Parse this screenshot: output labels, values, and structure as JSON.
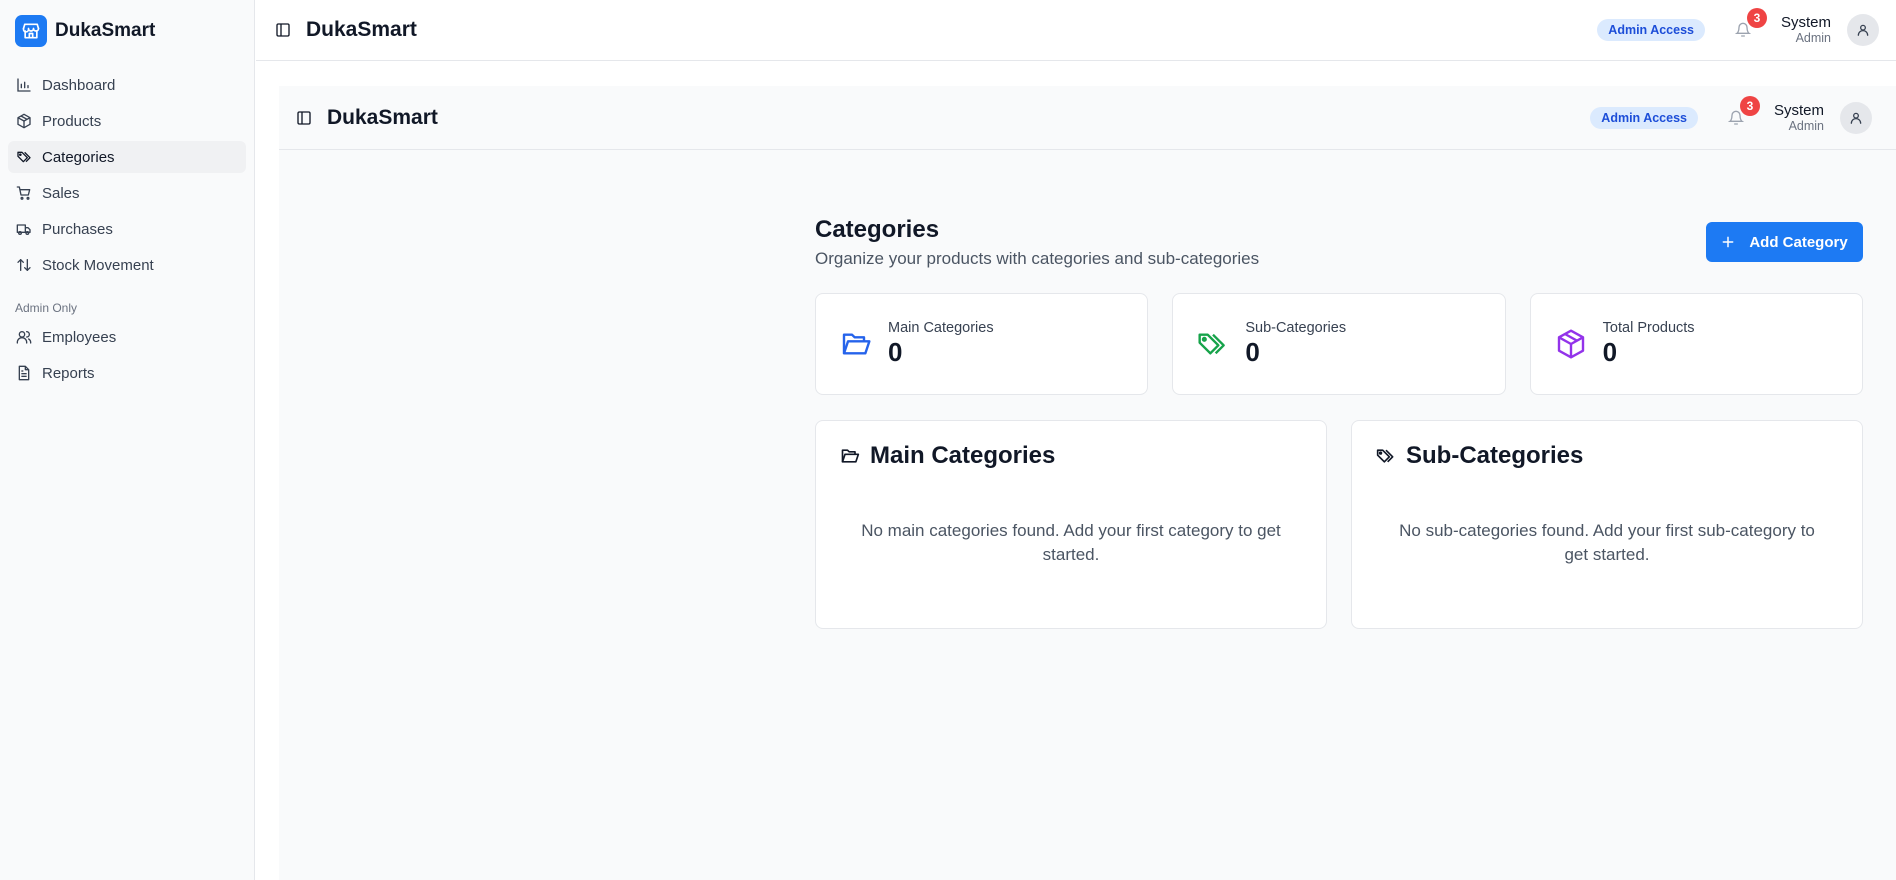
{
  "app": {
    "name": "DukaSmart"
  },
  "sidebar": {
    "items": [
      {
        "label": "Dashboard",
        "icon": "bar-chart-icon",
        "active": false
      },
      {
        "label": "Products",
        "icon": "package-icon",
        "active": false
      },
      {
        "label": "Categories",
        "icon": "tags-icon",
        "active": true
      },
      {
        "label": "Sales",
        "icon": "shopping-cart-icon",
        "active": false
      },
      {
        "label": "Purchases",
        "icon": "truck-icon",
        "active": false
      },
      {
        "label": "Stock Movement",
        "icon": "arrow-up-down-icon",
        "active": false
      }
    ],
    "admin_section_label": "Admin Only",
    "admin_items": [
      {
        "label": "Employees",
        "icon": "users-icon"
      },
      {
        "label": "Reports",
        "icon": "file-text-icon"
      }
    ]
  },
  "header": {
    "title": "DukaSmart",
    "access_badge": "Admin Access",
    "notification_count": "3",
    "user_name": "System",
    "user_role": "Admin"
  },
  "page": {
    "title": "Categories",
    "subtitle": "Organize your products with categories and sub-categories",
    "add_button_label": "Add Category"
  },
  "stats": [
    {
      "label": "Main Categories",
      "value": "0",
      "icon": "folder-open-icon",
      "color": "#2563eb"
    },
    {
      "label": "Sub-Categories",
      "value": "0",
      "icon": "tags-icon",
      "color": "#16a34a"
    },
    {
      "label": "Total Products",
      "value": "0",
      "icon": "package-icon",
      "color": "#9333ea"
    }
  ],
  "panels": {
    "main": {
      "title": "Main Categories",
      "empty_text": "No main categories found. Add your first category to get started."
    },
    "sub": {
      "title": "Sub-Categories",
      "empty_text": "No sub-categories found. Add your first sub-category to get started."
    }
  },
  "colors": {
    "accent": "#1d7af3",
    "badge_bg": "#dbeafe",
    "badge_text": "#1d4ed8",
    "notification": "#ef4444"
  }
}
